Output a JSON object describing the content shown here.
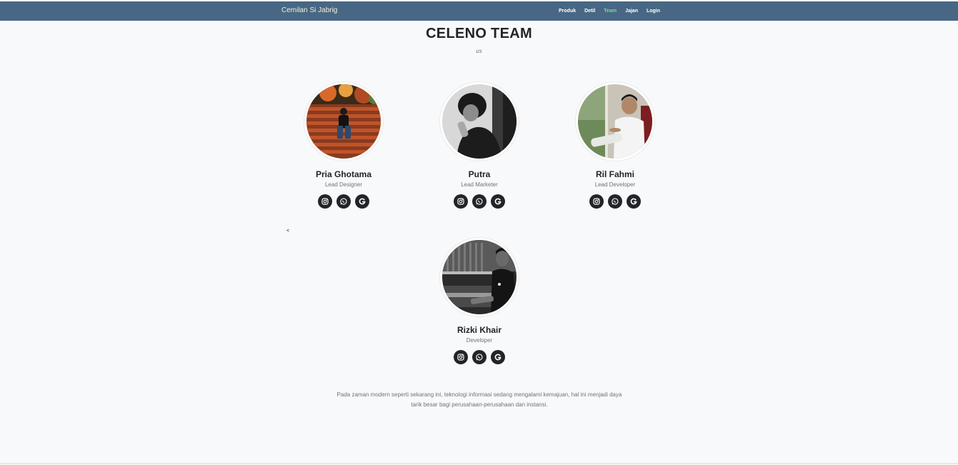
{
  "navbar": {
    "brand": "Cemilan Si Jabrig",
    "links": [
      {
        "label": "Produk",
        "active": false
      },
      {
        "label": "Detil",
        "active": false
      },
      {
        "label": "Team",
        "active": true
      },
      {
        "label": "Jajan",
        "active": false
      },
      {
        "label": "Login",
        "active": false
      }
    ],
    "colors": {
      "background": "#476784",
      "active_link": "#7ed4a3"
    }
  },
  "header": {
    "title": "CELENO TEAM",
    "subtitle": "us"
  },
  "team": [
    {
      "name": "Pria Ghotama",
      "role": "Lead Designer",
      "photo": "person-on-red-stairs"
    },
    {
      "name": "Putra",
      "role": "Lead Marketer",
      "photo": "person-grayscale-eating"
    },
    {
      "name": "Ril Fahmi",
      "role": "Lead Developer",
      "photo": "person-white-shirt-sitting"
    },
    {
      "name": "Rizki Khair",
      "role": "Developer",
      "photo": "person-grayscale-at-table"
    }
  ],
  "socials": [
    {
      "icon": "instagram-icon"
    },
    {
      "icon": "whatsapp-icon"
    },
    {
      "icon": "google-icon"
    }
  ],
  "stray_text": "<",
  "description": "Pada zaman modern seperti sekarang ini, teknologi informasi sedang mengalami kemajuan, hal ini menjadi daya tarik besar bagi perusahaan-perusahaan dan instansi."
}
